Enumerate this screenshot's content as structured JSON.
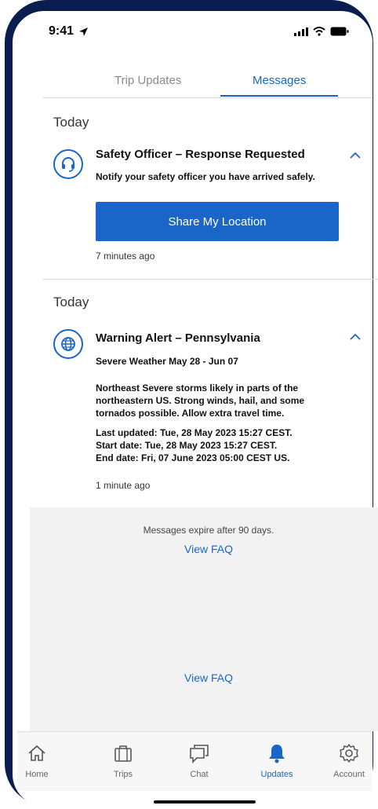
{
  "status_bar": {
    "time": "9:41"
  },
  "tabs": [
    {
      "label": "Trip Updates",
      "active": false
    },
    {
      "label": "Messages",
      "active": true
    }
  ],
  "messages": [
    {
      "day": "Today",
      "icon": "headset-icon",
      "title": "Safety Officer – Response Requested",
      "body": "Notify your safety officer you have arrived safely.",
      "button": "Share My Location",
      "ago": "7 minutes ago"
    },
    {
      "day": "Today",
      "icon": "globe-icon",
      "title": "Warning Alert – Pennsylvania",
      "subtitle": "Severe Weather May 28 - Jun 07",
      "body": "Northeast Severe storms likely in parts of the northeastern US. Strong winds, hail, and some tornados possible. Allow extra travel time.",
      "last_updated": "Last updated: Tue, 28 May 2023 15:27 CEST.",
      "start_date": "Start date: Tue, 28 May 2023 15:27 CEST.",
      "end_date": "End date: Fri, 07 June 2023 05:00 CEST US.",
      "ago": "1 minute ago"
    }
  ],
  "footer": {
    "expire_note": "Messages expire after 90 days.",
    "faq_link": "View FAQ",
    "faq_link_bottom": "View FAQ"
  },
  "nav": [
    {
      "label": "Home",
      "icon": "home-icon",
      "active": false
    },
    {
      "label": "Trips",
      "icon": "suitcase-icon",
      "active": false
    },
    {
      "label": "Chat",
      "icon": "chat-icon",
      "active": false
    },
    {
      "label": "Updates",
      "icon": "bell-icon",
      "active": true
    },
    {
      "label": "Account",
      "icon": "gear-icon",
      "active": false
    }
  ],
  "colors": {
    "accent": "#1a66c8",
    "frame": "#0b1d4f"
  }
}
